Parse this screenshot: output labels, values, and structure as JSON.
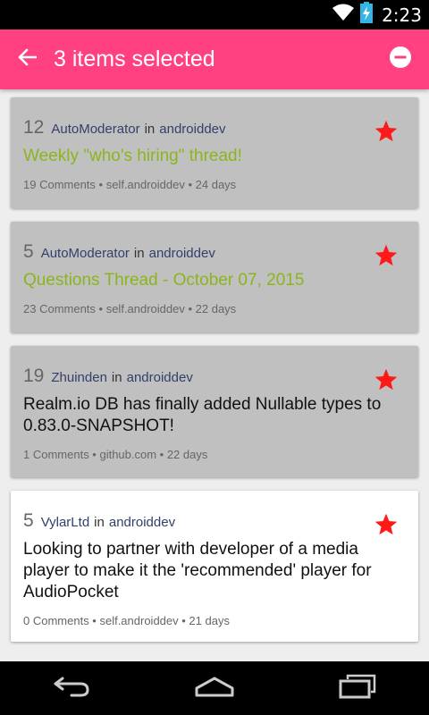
{
  "status_bar": {
    "time": "2:23",
    "icons": [
      "wifi-icon",
      "battery-charging-icon"
    ]
  },
  "app_bar": {
    "title": "3 items selected",
    "back_icon": "arrow-back-icon",
    "action_icon": "remove-circle-icon"
  },
  "colors": {
    "accent": "#ff4081",
    "selected_card": "#c0c0c0",
    "stickied_title": "#8bb51c",
    "star": "#ff1a1a"
  },
  "posts": [
    {
      "score": "12",
      "author": "AutoModerator",
      "in": "in",
      "subreddit": "androiddev",
      "title": "Weekly \"who's hiring\" thread!",
      "info": "19 Comments • self.androiddev • 24 days",
      "selected": true,
      "stickied": true,
      "starred": true
    },
    {
      "score": "5",
      "author": "AutoModerator",
      "in": "in",
      "subreddit": "androiddev",
      "title": "Questions Thread - October 07, 2015",
      "info": "23 Comments • self.androiddev • 22 days",
      "selected": true,
      "stickied": true,
      "starred": true
    },
    {
      "score": "19",
      "author": "Zhuinden",
      "in": "in",
      "subreddit": "androiddev",
      "title": "Realm.io DB has finally added Nullable types to 0.83.0-SNAPSHOT!",
      "info": "1 Comments • github.com • 22 days",
      "selected": true,
      "stickied": false,
      "starred": true
    },
    {
      "score": "5",
      "author": "VylarLtd",
      "in": "in",
      "subreddit": "androiddev",
      "title": "Looking to partner with developer of a media player to make it the 'recommended' player for AudioPocket",
      "info": "0 Comments • self.androiddev • 21 days",
      "selected": false,
      "stickied": false,
      "starred": true
    }
  ],
  "nav_bar": {
    "icons": [
      "back-nav-icon",
      "home-nav-icon",
      "recents-nav-icon"
    ]
  }
}
